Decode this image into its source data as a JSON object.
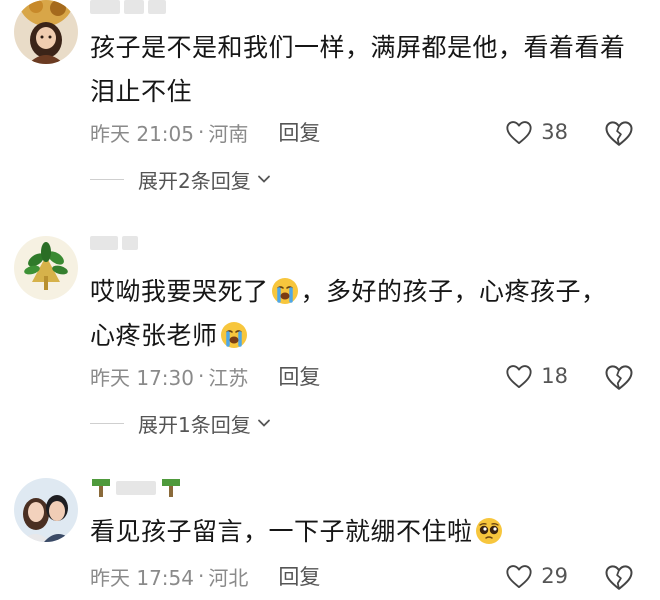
{
  "comments": [
    {
      "text": "孩子是不是和我们一样，满屏都是他，看着看着泪止不住",
      "time": "昨天 21:05",
      "separator": "·",
      "location": "河南",
      "reply_label": "回复",
      "likes": "38",
      "expand_label": "展开2条回复"
    },
    {
      "text_a": "哎呦我要哭死了",
      "text_b": "，多好的孩子，心疼孩子，心疼张老师",
      "time": "昨天 17:30",
      "separator": "·",
      "location": "江苏",
      "reply_label": "回复",
      "likes": "18",
      "expand_label": "展开1条回复"
    },
    {
      "text": "看见孩子留言，一下子就绷不住啦",
      "time": "昨天 17:54",
      "separator": "·",
      "location": "河北",
      "reply_label": "回复",
      "likes": "29"
    }
  ],
  "icons": {
    "like": "heart-outline-icon",
    "dislike": "broken-heart-icon",
    "expand": "chevron-down-icon",
    "emoji_cry": "loudly-crying-face-emoji",
    "emoji_plead": "pleading-face-emoji"
  },
  "colors": {
    "text": "#161616",
    "meta": "#8a8a8a",
    "action": "#555555"
  }
}
